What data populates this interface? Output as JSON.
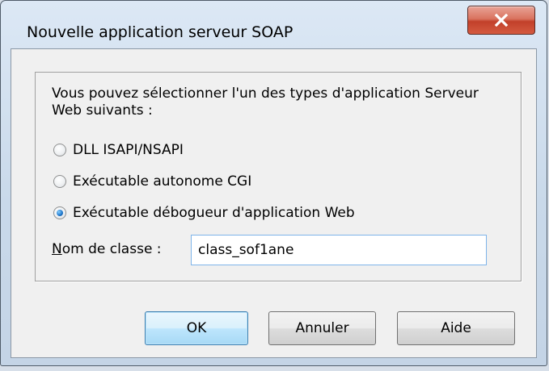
{
  "dialog": {
    "title": "Nouvelle application serveur SOAP",
    "close_icon": "close-x-icon",
    "description": "Vous pouvez sélectionner l'un des types d'application Serveur Web suivants :",
    "options": [
      {
        "label": "DLL ISAPI/NSAPI",
        "checked": false
      },
      {
        "label": "Exécutable autonome CGI",
        "checked": false
      },
      {
        "label": "Exécutable débogueur d'application Web",
        "checked": true
      }
    ],
    "class_name": {
      "label_mnemonic": "N",
      "label_rest": "om de classe :",
      "value": "class_sof1ane"
    },
    "buttons": {
      "ok": "OK",
      "cancel": "Annuler",
      "help": "Aide"
    }
  },
  "colors": {
    "close_button": "#c7432d",
    "default_button_border": "#3c7fb1",
    "input_border": "#7eb4ea"
  }
}
